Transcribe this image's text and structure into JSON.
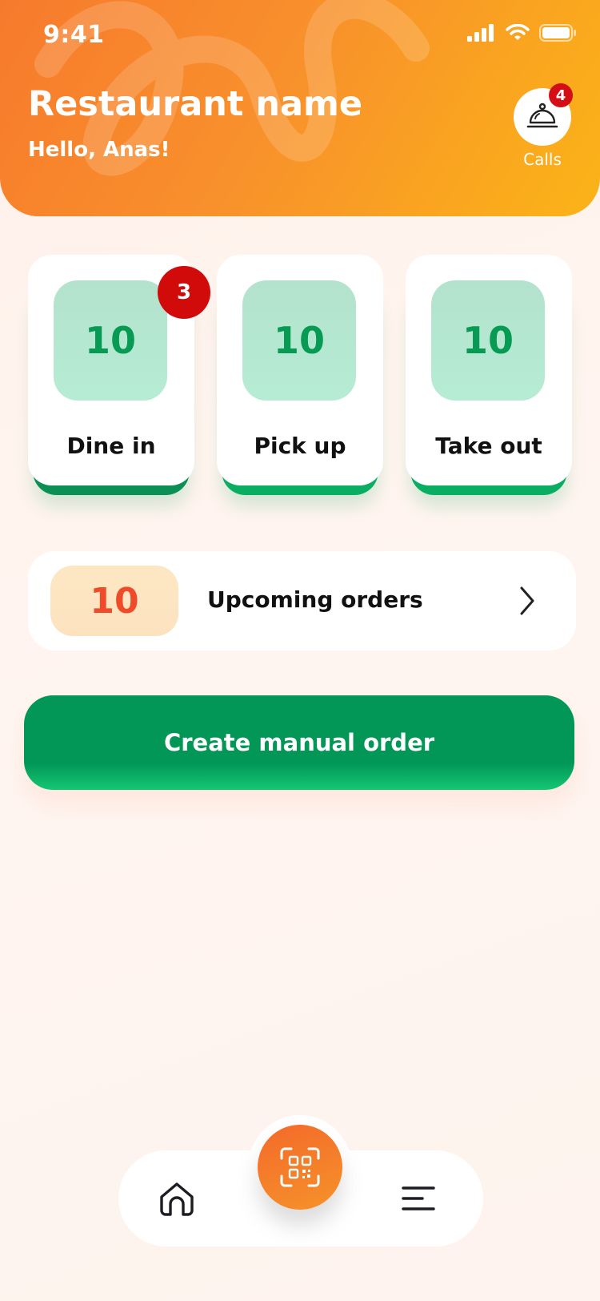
{
  "status_bar": {
    "time": "9:41"
  },
  "header": {
    "title": "Restaurant name",
    "greeting": "Hello, Anas!",
    "calls": {
      "label": "Calls",
      "badge": "4"
    }
  },
  "order_types": [
    {
      "label": "Dine in",
      "count": "10",
      "badge": "3"
    },
    {
      "label": "Pick up",
      "count": "10"
    },
    {
      "label": "Take out",
      "count": "10"
    }
  ],
  "upcoming": {
    "count": "10",
    "label": "Upcoming orders"
  },
  "create_button": {
    "label": "Create manual order"
  },
  "bottom_nav": {
    "icons": [
      "home-icon",
      "qr-scan-icon",
      "menu-icon"
    ]
  },
  "colors": {
    "header_start": "#f77a2c",
    "header_end": "#fbb417",
    "green": "#029757",
    "badge_red": "#d10a0a",
    "upcoming_count": "#ef4b2a"
  }
}
